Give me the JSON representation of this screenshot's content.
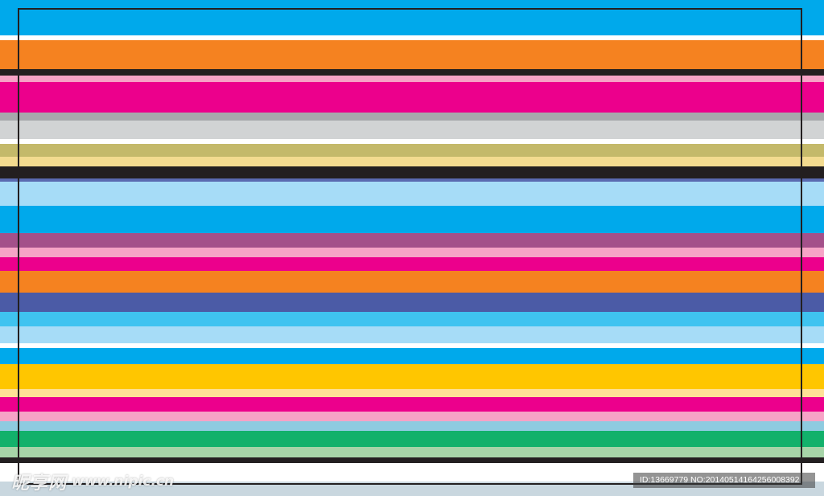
{
  "pattern": {
    "stripe_colors": [
      "#00a9eb",
      "#ffffff",
      "#f58220",
      "#231f20",
      "#f6a3c6",
      "#ec008c",
      "#a7a9ac",
      "#d1d3d4",
      "#ffffff",
      "#c4b96a",
      "#f3db8f",
      "#231f20",
      "#5a6ab0",
      "#a6dcf7",
      "#00a9eb",
      "#a4508a",
      "#f6a3c6",
      "#ec008c",
      "#f58220",
      "#4b5ba6",
      "#3fc3f0",
      "#a6dcf7",
      "#ffffff",
      "#00a9eb",
      "#ffc600",
      "#ffe196",
      "#ec008c",
      "#f6a3c6",
      "#8ecbe0",
      "#12b16b",
      "#a6d4a8",
      "#231f20",
      "#ffffff",
      "#c9d7df"
    ],
    "frame_color": "#231f20"
  },
  "watermark": {
    "brand": "昵享网",
    "url": "www.nipic.cn",
    "id_text": "ID:13669779 NO:20140514164256008392"
  }
}
